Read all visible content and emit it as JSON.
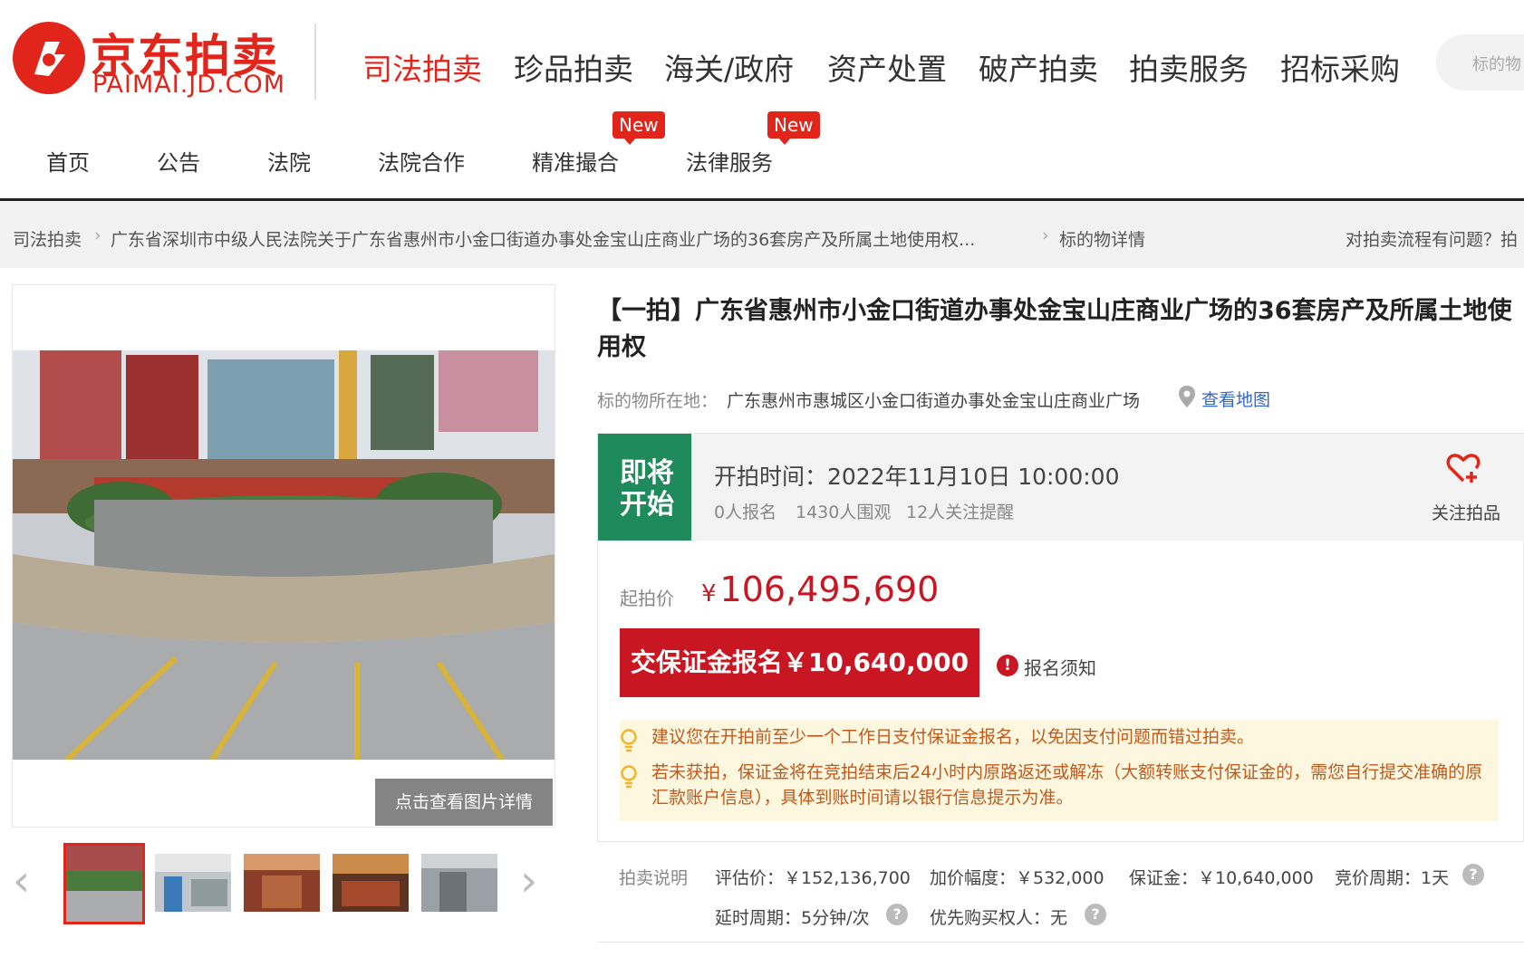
{
  "header": {
    "logo_cn": "京东拍卖",
    "logo_en": "PAIMAI.JD.COM",
    "main_nav": [
      "司法拍卖",
      "珍品拍卖",
      "海关/政府",
      "资产处置",
      "破产拍卖",
      "拍卖服务",
      "招标采购"
    ],
    "search_placeholder": "标的物"
  },
  "sub_nav": {
    "items": [
      "首页",
      "公告",
      "法院",
      "法院合作",
      "精准撮合",
      "法律服务"
    ],
    "badge": "New"
  },
  "breadcrumb": {
    "items": [
      "司法拍卖",
      "广东省深圳市中级人民法院关于广东省惠州市小金口街道办事处金宝山庄商业广场的36套房产及所属土地使用权...",
      "标的物详情"
    ],
    "help": "对拍卖流程有问题？拍"
  },
  "gallery": {
    "photo_detail_label": "点击查看图片详情",
    "thumbnail_count": 5
  },
  "item": {
    "title": "【一拍】广东省惠州市小金口街道办事处金宝山庄商业广场的36套房产及所属土地使用权",
    "location_label": "标的物所在地：",
    "location": "广东惠州市惠城区小金口街道办事处金宝山庄商业广场",
    "map_link": "查看地图"
  },
  "status": {
    "badge": "即将开始",
    "start_time": "开拍时间：2022年11月10日 10:00:00",
    "stats": [
      "0人报名",
      "1430人围观",
      "12人关注提醒"
    ],
    "follow_label": "关注拍品"
  },
  "price": {
    "label": "起拍价",
    "currency": "¥",
    "value": "106,495,690",
    "deposit_button": "交保证金报名￥10,640,000",
    "notice_link": "报名须知"
  },
  "tips": [
    "建议您在开拍前至少一个工作日支付保证金报名，以免因支付问题而错过拍卖。",
    "若未获拍，保证金将在竞拍结束后24小时内原路返还或解冻（大额转账支付保证金的，需您自行提交准确的原汇款账户信息），具体到账时间请以银行信息提示为准。"
  ],
  "auction_info": {
    "label": "拍卖说明",
    "items": [
      "评估价：￥152,136,700",
      "加价幅度：￥532,000",
      "保证金：￥10,640,000",
      "竞价周期：1天",
      "延时周期：5分钟/次",
      "优先购买权人：无"
    ]
  },
  "colors": {
    "brand_red": "#e1251b",
    "price_red": "#c81623",
    "status_green": "#1f8a5b",
    "link_blue": "#3366cc",
    "tip_orange": "#c4581b"
  }
}
